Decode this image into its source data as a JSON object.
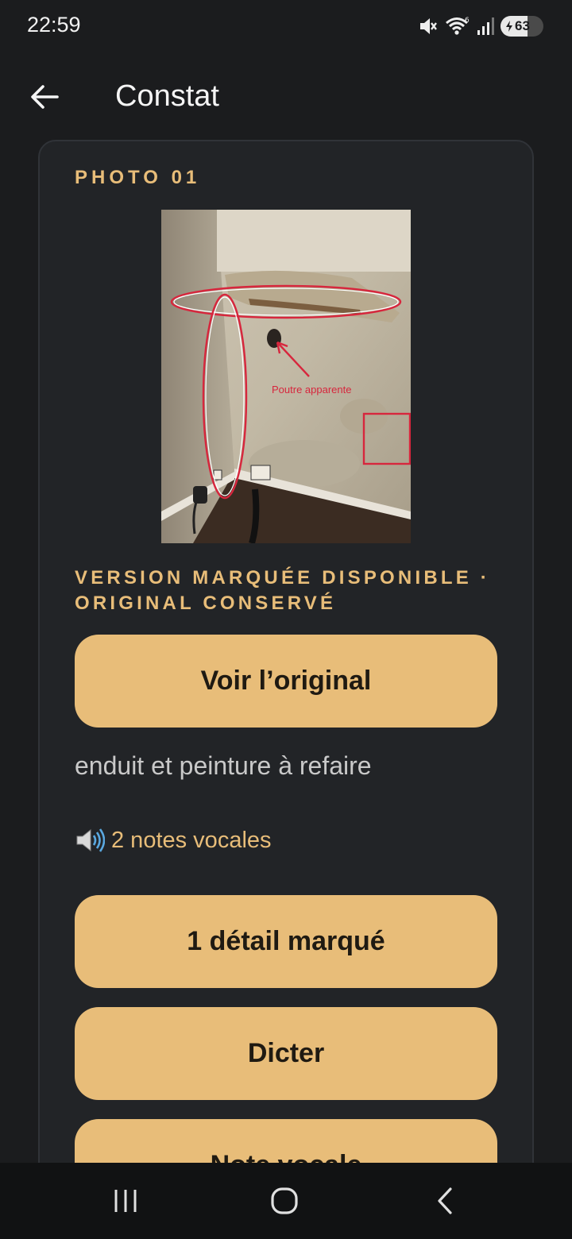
{
  "status_bar": {
    "time": "22:59",
    "battery_level": "63",
    "icons": [
      "mute-icon",
      "wifi-icon",
      "signal-icon",
      "battery-charging-icon"
    ]
  },
  "app_bar": {
    "title": "Constat",
    "back_icon": "arrow-left-icon"
  },
  "card": {
    "photo_label": "PHOTO 01",
    "annotation_text": "Poutre apparente",
    "version_text": "VERSION MARQUÉE DISPONIBLE · ORIGINAL CONSERVÉ",
    "original_button": "Voir l’original",
    "note": "enduit et peinture à refaire",
    "voice_icon": "speaker-icon",
    "voice_notes": "2 notes vocales",
    "detail_button": "1 détail marqué",
    "dicter_button": "Dicter",
    "note_button": "Note vocale"
  },
  "nav_bar": {
    "icons": [
      "recent-apps-icon",
      "home-icon",
      "back-icon"
    ]
  },
  "colors": {
    "accent": "#e8bd79",
    "background": "#1b1c1e",
    "card": "#222427",
    "annotation": "#d7263d"
  }
}
